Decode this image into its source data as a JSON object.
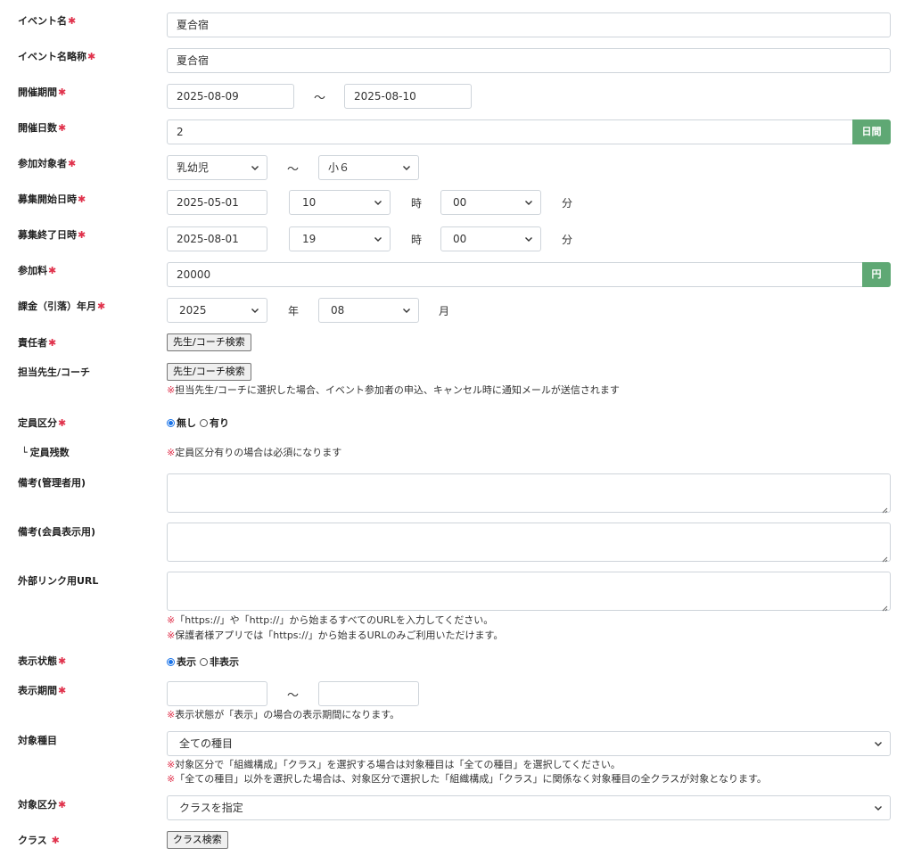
{
  "required_mark": "✱",
  "fields": {
    "event_name": {
      "label": "イベント名",
      "value": "夏合宿"
    },
    "event_short": {
      "label": "イベント名略称",
      "value": "夏合宿"
    },
    "period": {
      "label": "開催期間",
      "start": "2025-08-09",
      "tilde": "～",
      "end": "2025-08-10"
    },
    "days": {
      "label": "開催日数",
      "value": "2",
      "addon": "日間"
    },
    "target": {
      "label": "参加対象者",
      "from": "乳幼児",
      "tilde": "～",
      "to": "小６"
    },
    "recruit_start": {
      "label": "募集開始日時",
      "date": "2025-05-01",
      "hour": "10",
      "hour_unit": "時",
      "minute": "00",
      "minute_unit": "分"
    },
    "recruit_end": {
      "label": "募集終了日時",
      "date": "2025-08-01",
      "hour": "19",
      "hour_unit": "時",
      "minute": "00",
      "minute_unit": "分"
    },
    "fee": {
      "label": "参加料",
      "value": "20000",
      "addon": "円"
    },
    "billing": {
      "label": "課金（引落）年月",
      "year": "2025",
      "year_unit": "年",
      "month": "08",
      "month_unit": "月"
    },
    "manager": {
      "label": "責任者",
      "button": "先生/コーチ検索"
    },
    "coach": {
      "label": "担当先生/コーチ",
      "button": "先生/コーチ検索",
      "note_mark": "※",
      "note": "担当先生/コーチに選択した場合、イベント参加者の申込、キャンセル時に通知メールが送信されます"
    },
    "capacity_type": {
      "label": "定員区分",
      "options": [
        "無し",
        "有り"
      ],
      "selected": 0
    },
    "capacity_left": {
      "prefix": "└",
      "label": "定員残数",
      "note_mark": "※",
      "note": "定員区分有りの場合は必須になります"
    },
    "remarks_admin": {
      "label": "備考(管理者用)"
    },
    "remarks_member": {
      "label": "備考(会員表示用)"
    },
    "external_url": {
      "label": "外部リンク用URL",
      "note1_mark": "※",
      "note1": "「https://」や「http://」から始まるすべてのURLを入力してください。",
      "note2_mark": "※",
      "note2": "保護者様アプリでは「https://」から始まるURLのみご利用いただけます。"
    },
    "display_state": {
      "label": "表示状態",
      "options": [
        "表示",
        "非表示"
      ],
      "selected": 0
    },
    "display_period": {
      "label": "表示期間",
      "tilde": "～",
      "note_mark": "※",
      "note": "表示状態が「表示」の場合の表示期間になります。"
    },
    "target_item": {
      "label": "対象種目",
      "value": "全ての種目",
      "note1_mark": "※",
      "note1": "対象区分で「組織構成」「クラス」を選択する場合は対象種目は「全ての種目」を選択してください。",
      "note2_mark": "※",
      "note2": "「全ての種目」以外を選択した場合は、対象区分で選択した「組織構成」「クラス」に関係なく対象種目の全クラスが対象となります。"
    },
    "target_category": {
      "label": "対象区分",
      "value": "クラスを指定"
    },
    "class": {
      "label": "クラス ",
      "button": "クラス検索"
    }
  },
  "icons": {
    "select": "chevron-down-icon",
    "resize": "resize-grip-icon"
  },
  "colors": {
    "required": "#e0314b",
    "addon": "#5fa874",
    "radio": "#1a73e8"
  }
}
